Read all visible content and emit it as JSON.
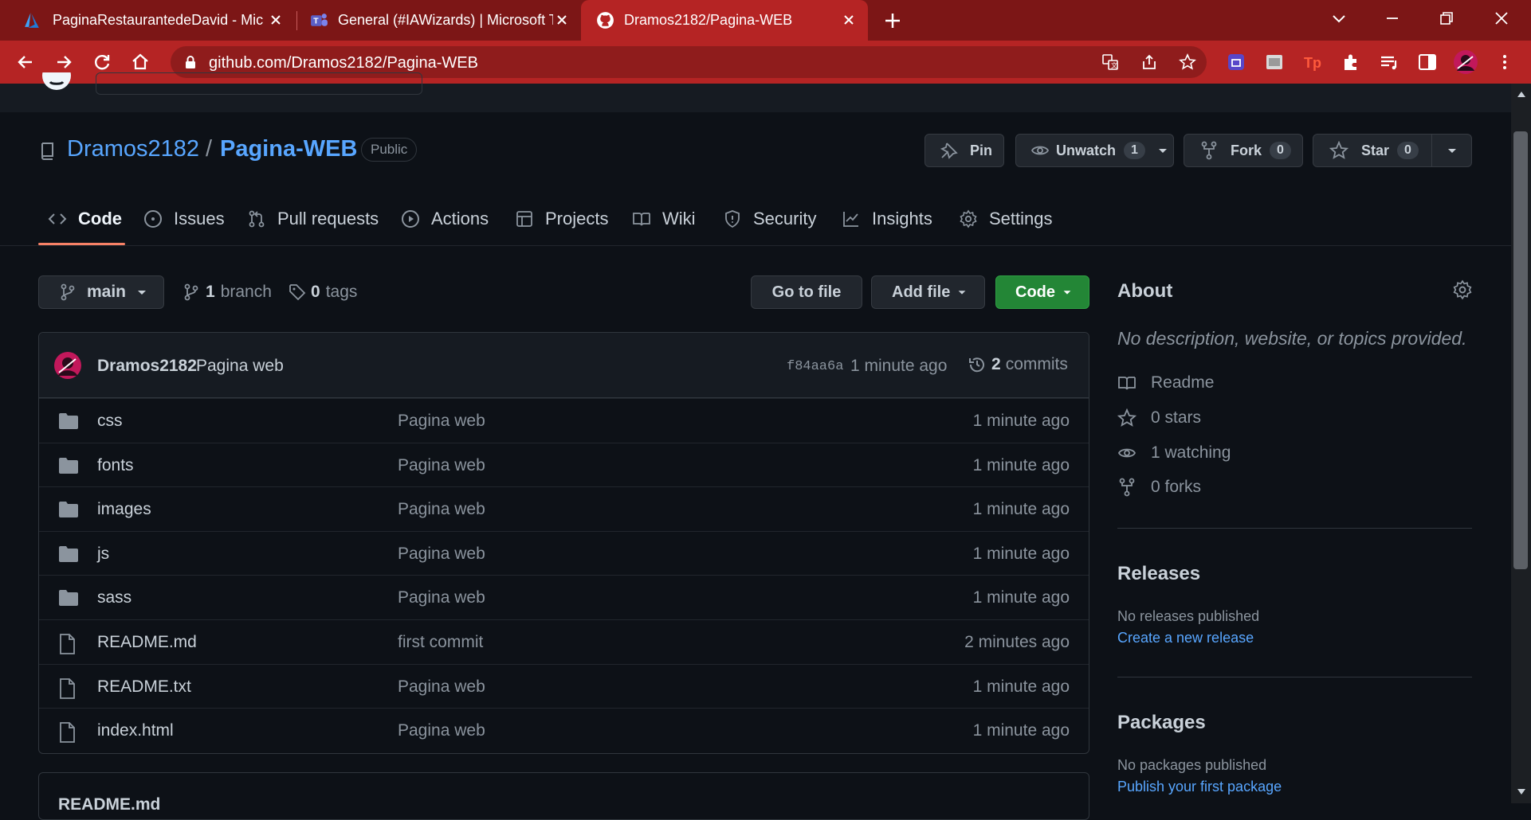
{
  "browser": {
    "tabs": [
      {
        "title": "PaginaRestaurantedeDavid - Microsoft Azure",
        "icon": "azure-icon"
      },
      {
        "title": "General (#IAWizards) | Microsoft Teams",
        "icon": "teams-icon"
      },
      {
        "title": "Dramos2182/Pagina-WEB",
        "icon": "github-icon"
      }
    ],
    "url": "github.com/Dramos2182/Pagina-WEB"
  },
  "repo": {
    "owner": "Dramos2182",
    "separator": "/",
    "name": "Pagina-WEB",
    "visibility": "Public",
    "pin_label": "Pin",
    "unwatch_label": "Unwatch",
    "unwatch_count": "1",
    "fork_label": "Fork",
    "fork_count": "0",
    "star_label": "Star",
    "star_count": "0"
  },
  "nav": [
    "Code",
    "Issues",
    "Pull requests",
    "Actions",
    "Projects",
    "Wiki",
    "Security",
    "Insights",
    "Settings"
  ],
  "branchbar": {
    "branch": "main",
    "branch_count": "1",
    "branch_word": "branch",
    "tag_count": "0",
    "tag_word": "tags",
    "go_to_file": "Go to file",
    "add_file": "Add file",
    "code": "Code"
  },
  "commit": {
    "author": "Dramos2182",
    "message": "Pagina web",
    "sha": "f84aa6a",
    "time": "1 minute ago",
    "count": "2",
    "count_word": "commits"
  },
  "files": [
    {
      "name": "css",
      "type": "folder",
      "message": "Pagina web",
      "age": "1 minute ago"
    },
    {
      "name": "fonts",
      "type": "folder",
      "message": "Pagina web",
      "age": "1 minute ago"
    },
    {
      "name": "images",
      "type": "folder",
      "message": "Pagina web",
      "age": "1 minute ago"
    },
    {
      "name": "js",
      "type": "folder",
      "message": "Pagina web",
      "age": "1 minute ago"
    },
    {
      "name": "sass",
      "type": "folder",
      "message": "Pagina web",
      "age": "1 minute ago"
    },
    {
      "name": "README.md",
      "type": "file",
      "message": "first commit",
      "age": "2 minutes ago"
    },
    {
      "name": "README.txt",
      "type": "file",
      "message": "Pagina web",
      "age": "1 minute ago"
    },
    {
      "name": "index.html",
      "type": "file",
      "message": "Pagina web",
      "age": "1 minute ago"
    }
  ],
  "about": {
    "title": "About",
    "description": "No description, website, or topics provided.",
    "readme": "Readme",
    "stars": "0 stars",
    "watching": "1 watching",
    "forks": "0 forks"
  },
  "releases": {
    "title": "Releases",
    "none": "No releases published",
    "create": "Create a new release"
  },
  "packages": {
    "title": "Packages",
    "none": "No packages published",
    "publish": "Publish your first package"
  },
  "readme_box": {
    "title": "README.md"
  },
  "colors": {
    "chrome_tabbar": "#7c1616",
    "chrome_toolbar": "#b52424",
    "github_bg": "#0d1117",
    "link": "#58a6ff",
    "code_button": "#238636",
    "tab_underline": "#f78166"
  }
}
